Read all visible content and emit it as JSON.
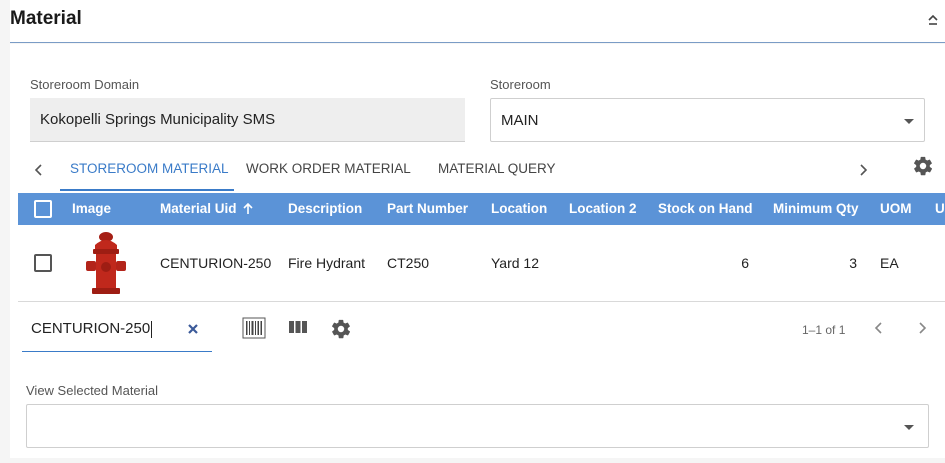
{
  "panel": {
    "title": "Material"
  },
  "storeroom_domain": {
    "label": "Storeroom Domain",
    "value": "Kokopelli Springs Municipality SMS"
  },
  "storeroom": {
    "label": "Storeroom",
    "value": "MAIN"
  },
  "tabs": [
    {
      "label": "STOREROOM MATERIAL",
      "active": true
    },
    {
      "label": "WORK ORDER MATERIAL",
      "active": false
    },
    {
      "label": "MATERIAL QUERY",
      "active": false
    }
  ],
  "grid": {
    "columns": [
      "Image",
      "Material Uid",
      "Description",
      "Part Number",
      "Location",
      "Location 2",
      "Stock on Hand",
      "Minimum Qty",
      "UOM",
      "U"
    ],
    "rows": [
      {
        "material_uid": "CENTURION-250",
        "description": "Fire Hydrant",
        "part_number": "CT250",
        "location": "Yard 12",
        "location2": "",
        "stock_on_hand": "6",
        "minimum_qty": "3",
        "uom": "EA"
      }
    ]
  },
  "search": {
    "value": "CENTURION-250"
  },
  "pager": {
    "text": "1–1 of 1"
  },
  "view_selected": {
    "label": "View Selected Material",
    "value": ""
  },
  "colors": {
    "accent": "#3a7bc8",
    "header_bg": "#5b93d7",
    "hydrant": "#c0281c"
  }
}
